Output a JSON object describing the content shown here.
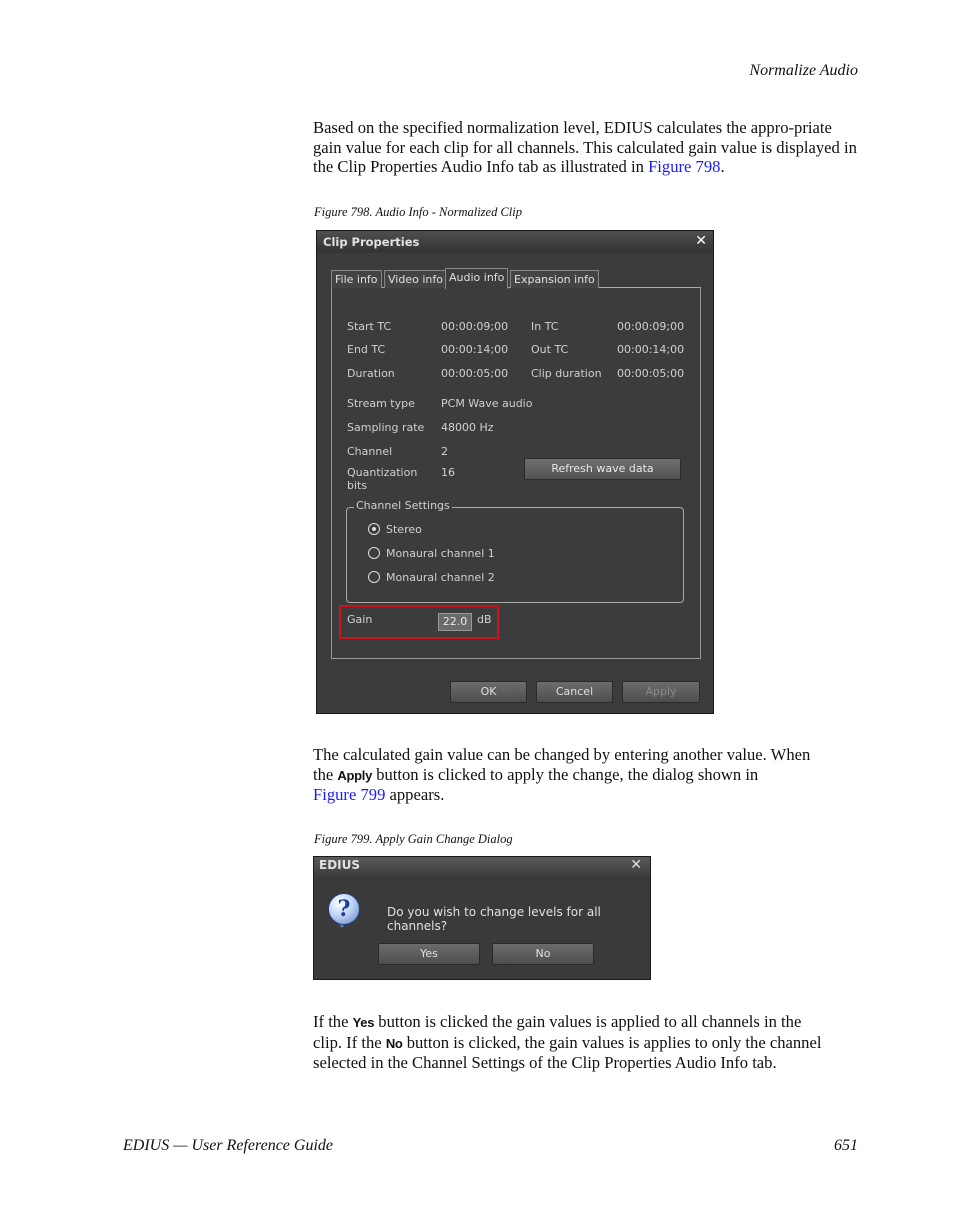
{
  "header": {
    "section_title": "Normalize Audio"
  },
  "para1": {
    "text": "Based on the specified normalization level, EDIUS calculates the appro-priate gain value for each clip for all channels. This calculated gain value is displayed in the Clip Properties Audio Info tab as illustrated in ",
    "link": "Figure 798",
    "end": "."
  },
  "figure798": {
    "caption": "Figure 798.  Audio Info - Normalized Clip",
    "title": "Clip Properties",
    "close": "✕",
    "tabs": [
      "File info",
      "Video info",
      "Audio info",
      "Expansion info"
    ],
    "rows": [
      {
        "label": "Start TC",
        "value": "00:00:09;00",
        "label2": "In TC",
        "value2": "00:00:09;00"
      },
      {
        "label": "End TC",
        "value": "00:00:14;00",
        "label2": "Out TC",
        "value2": "00:00:14;00"
      },
      {
        "label": "Duration",
        "value": "00:00:05;00",
        "label2": "Clip duration",
        "value2": "00:00:05;00"
      }
    ],
    "stream_type": {
      "label": "Stream type",
      "value": "PCM Wave audio"
    },
    "sampling_rate": {
      "label": "Sampling rate",
      "value": "48000 Hz"
    },
    "channel": {
      "label": "Channel",
      "value": "2"
    },
    "quantization": {
      "label_line1": "Quantization",
      "label_line2": "bits",
      "value": "16"
    },
    "refresh_button": "Refresh wave data",
    "channel_settings": {
      "label": "Channel Settings",
      "options": [
        "Stereo",
        "Monaural channel 1",
        "Monaural channel 2"
      ],
      "selected": "Stereo"
    },
    "gain": {
      "label": "Gain",
      "value": "22.0",
      "unit": "dB"
    },
    "buttons": {
      "ok": "OK",
      "cancel": "Cancel",
      "apply": "Apply"
    }
  },
  "para2": {
    "line1": "The calculated gain value can be changed by entering another value. When",
    "pre": "the ",
    "kw": "Apply",
    "post": " button is clicked to apply the change, the dialog shown in",
    "link": "Figure 799",
    "end": " appears."
  },
  "figure799": {
    "caption": "Figure 799.  Apply Gain Change Dialog",
    "title": "EDIUS",
    "close": "✕",
    "icon": "?",
    "message": "Do you wish to change levels for all channels?",
    "yes": "Yes",
    "no": "No"
  },
  "para3": {
    "pre1": "If the ",
    "kw1": "Yes",
    "post1": " button is clicked the gain values is applied to all channels in the",
    "pre2": "clip. If the ",
    "kw2": "No",
    "post2": " button is clicked, the gain values is applies to only the channel",
    "line3": "selected in the Channel Settings of the Clip Properties Audio Info tab."
  },
  "footer": {
    "left": "EDIUS  —  User Reference Guide",
    "page": "651"
  }
}
